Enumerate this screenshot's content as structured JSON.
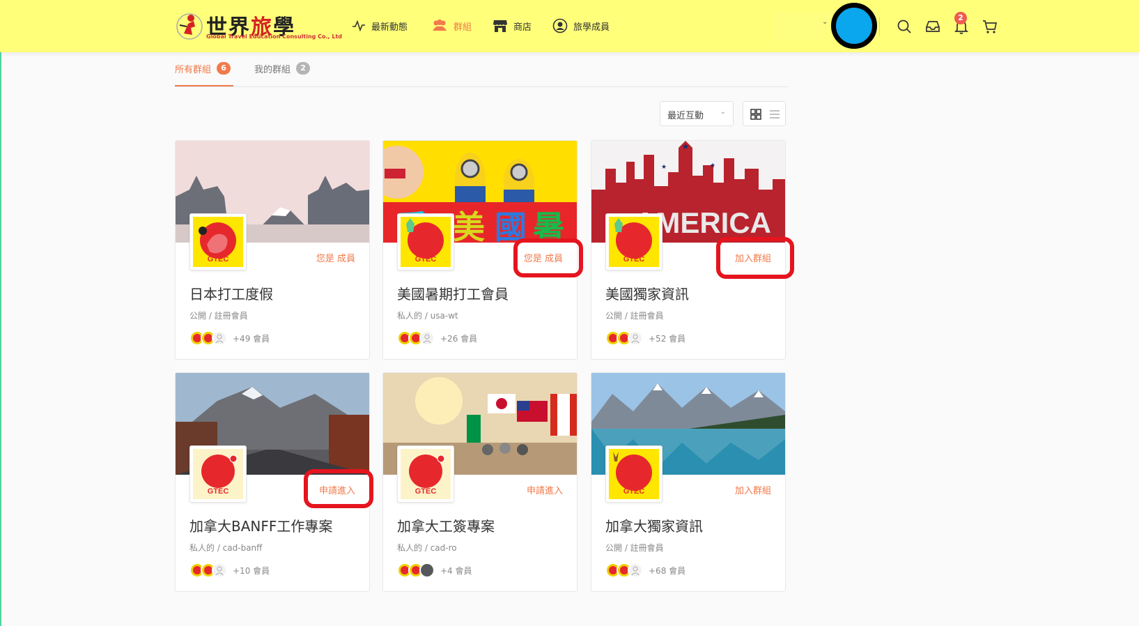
{
  "header": {
    "logo_title_part1": "世界",
    "logo_title_part2": "旅",
    "logo_title_part3": "學",
    "logo_subtitle": "Global Travel Education Consulting Co., Ltd",
    "nav": [
      {
        "label": "最新動態",
        "icon": "activity-icon"
      },
      {
        "label": "群組",
        "icon": "users-icon"
      },
      {
        "label": "商店",
        "icon": "store-icon"
      },
      {
        "label": "旅學成員",
        "icon": "user-circle-icon"
      }
    ],
    "notification_count": "2"
  },
  "tabs": [
    {
      "label": "所有群組",
      "count": "6"
    },
    {
      "label": "我的群組",
      "count": "2"
    }
  ],
  "sort": {
    "selected": "最近互動"
  },
  "groups": [
    {
      "title": "日本打工度假",
      "meta": "公開 / 註冊會員",
      "members": "+49 會員",
      "action": "您是 成員",
      "avatar_text": "GTEC"
    },
    {
      "title": "美國暑期打工會員",
      "meta": "私人的 / usa-wt",
      "members": "+26 會員",
      "action": "您是 成員",
      "avatar_text": "GTEC"
    },
    {
      "title": "美國獨家資訊",
      "meta": "公開 / 註冊會員",
      "members": "+52 會員",
      "action": "加入群組",
      "avatar_text": "GTEC",
      "cover_text": "AMERICA"
    },
    {
      "title": "加拿大BANFF工作專案",
      "meta": "私人的 / cad-banff",
      "members": "+10 會員",
      "action": "申請進入",
      "avatar_text": "GTEC"
    },
    {
      "title": "加拿大工簽專案",
      "meta": "私人的 / cad-ro",
      "members": "+4 會員",
      "action": "申請進入",
      "avatar_text": "GTEC"
    },
    {
      "title": "加拿大獨家資訊",
      "meta": "公開 / 註冊會員",
      "members": "+68 會員",
      "action": "加入群組",
      "avatar_text": "GTEC"
    }
  ],
  "colors": {
    "header_bg": "#ffff7a",
    "accent": "#f07a4b",
    "highlight": "#e5141e",
    "avatar_blue": "#0aa6ee"
  }
}
